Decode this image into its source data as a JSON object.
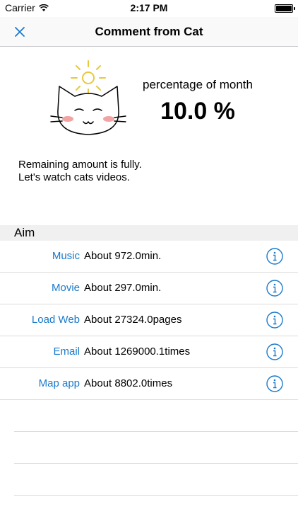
{
  "status": {
    "carrier": "Carrier",
    "time": "2:17 PM"
  },
  "nav": {
    "title": "Comment from Cat",
    "close_icon": "close-icon"
  },
  "header": {
    "percentage_label": "percentage of month",
    "percentage_value": "10.0 %"
  },
  "message": {
    "line1": "Remaining amount is fully.",
    "line2": "Let's watch cats videos."
  },
  "section": {
    "title": "Aim"
  },
  "rows": [
    {
      "label": "Music",
      "value": "About 972.0min."
    },
    {
      "label": "Movie",
      "value": "About 297.0min."
    },
    {
      "label": "Load Web",
      "value": "About 27324.0pages"
    },
    {
      "label": "Email",
      "value": "About 1269000.1times"
    },
    {
      "label": "Map app",
      "value": "About 8802.0times"
    }
  ],
  "colors": {
    "accent": "#1a7acb",
    "sun": "#e8c93a",
    "blush": "#f2a3a3"
  }
}
